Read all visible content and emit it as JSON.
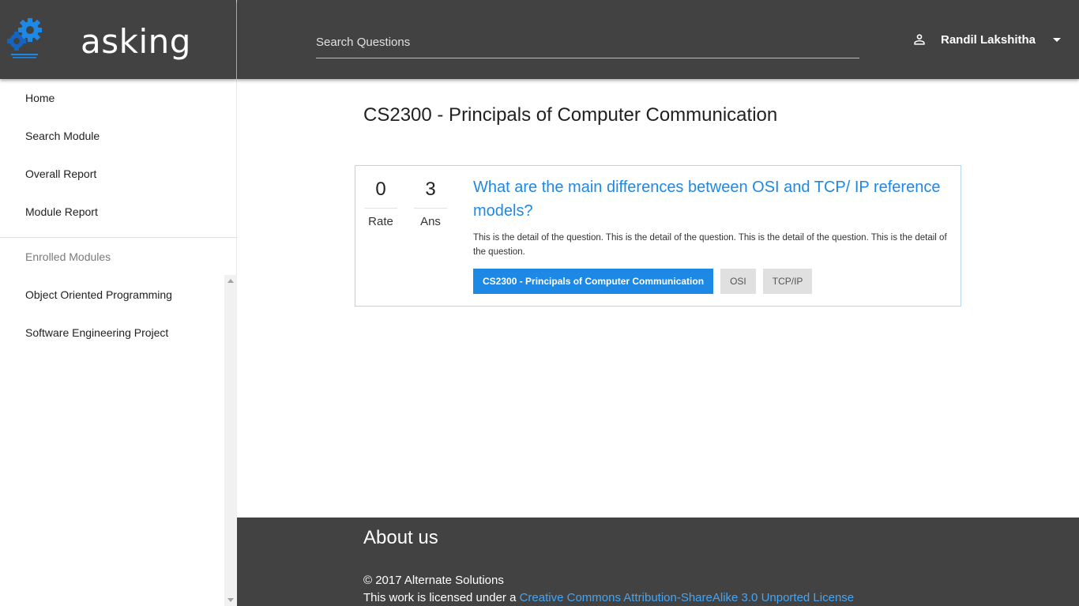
{
  "app": {
    "name": "asking"
  },
  "colors": {
    "accent": "#1e88e5",
    "header_bg": "#424242",
    "link": "#42a5f5"
  },
  "search": {
    "placeholder": "Search Questions",
    "value": ""
  },
  "user": {
    "name": "Randil Lakshitha"
  },
  "sidebar": {
    "items": [
      {
        "label": "Home"
      },
      {
        "label": "Search Module"
      },
      {
        "label": "Overall Report"
      },
      {
        "label": "Module Report"
      }
    ],
    "enrolled_header": "Enrolled Modules",
    "enrolled": [
      {
        "label": "Object Oriented Programming"
      },
      {
        "label": "Software Engineering Project"
      }
    ]
  },
  "main": {
    "title": "CS2300 - Principals of Computer Communication",
    "question": {
      "rate_value": "0",
      "rate_label": "Rate",
      "ans_value": "3",
      "ans_label": "Ans",
      "title": "What are the main differences between OSI and TCP/ IP reference models?",
      "detail": "This is the detail of the question. This is the detail of the question. This is the detail of the question. This is the detail of the question.",
      "tags": [
        {
          "label": "CS2300 - Principals of Computer Communication"
        },
        {
          "label": "OSI"
        },
        {
          "label": "TCP/IP"
        }
      ]
    }
  },
  "footer": {
    "title": "About us",
    "copyright": "© 2017 Alternate Solutions",
    "license_prefix": "This work is licensed under a ",
    "license_link": "Creative Commons Attribution-ShareAlike 3.0 Unported License"
  }
}
